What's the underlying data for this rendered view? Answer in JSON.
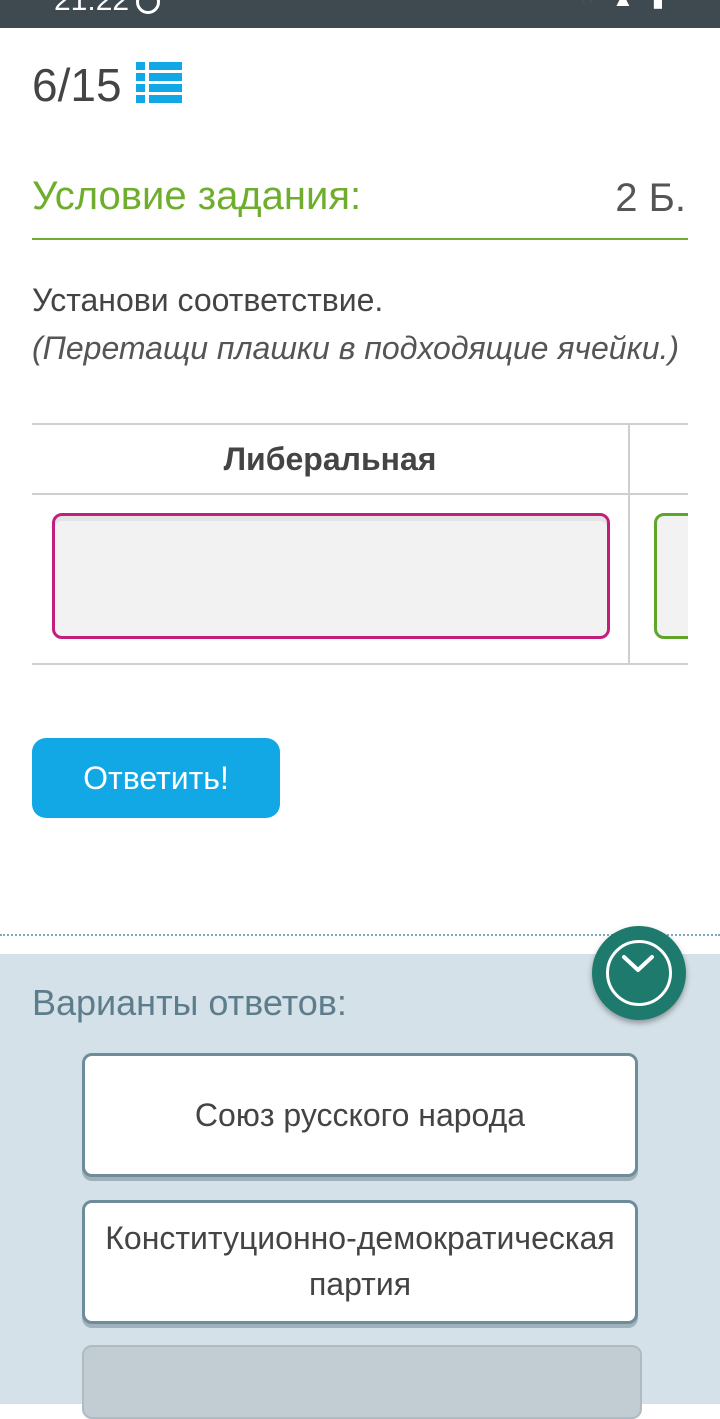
{
  "status_bar": {
    "time": "21:22"
  },
  "header": {
    "counter": "6/15",
    "list_icon": "list-icon"
  },
  "task": {
    "title": "Условие задания:",
    "points": "2 Б.",
    "instruction_main": "Установи соответствие.",
    "instruction_sub": "(Перетащи плашки в подходящие ячейки.)"
  },
  "table": {
    "columns": [
      "Либеральная"
    ]
  },
  "answer_button": {
    "label": "Ответить!"
  },
  "options": {
    "title": "Варианты ответов:",
    "items": [
      "Союз русского народа",
      "Конституционно-демократическая партия"
    ],
    "collapse_icon": "chevron-down-icon"
  },
  "colors": {
    "accent_green": "#6fae2c",
    "button_blue": "#12a8e6",
    "drop_cell_pink": "#c31e7e",
    "drop_cell_green": "#5fa52a",
    "panel_bg": "#d4e1e8",
    "fab_teal": "#1e7a6c"
  }
}
